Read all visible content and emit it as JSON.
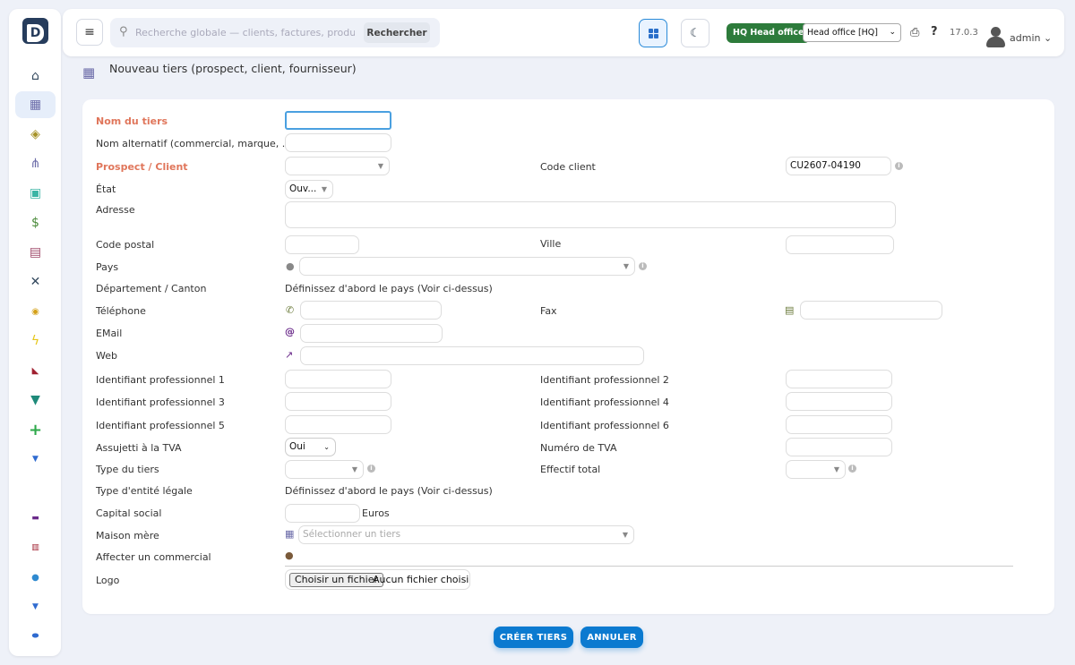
{
  "header": {
    "search_placeholder": "Recherche globale — clients, factures, produits...",
    "search_button": "Rechercher",
    "hq_badge": "HQ Head office",
    "hq_select": "Head office [HQ]",
    "version": "17.0.3",
    "user": "admin"
  },
  "page": {
    "title": "Nouveau tiers (prospect, client, fournisseur)"
  },
  "form": {
    "nom_tiers": "Nom du tiers",
    "nom_alternatif": "Nom alternatif (commercial, marque, ...)",
    "prospect_client": "Prospect / Client",
    "code_client_label": "Code client",
    "code_client_value": "CU2607-04190",
    "etat_label": "État",
    "etat_value": "Ouv...",
    "adresse": "Adresse",
    "code_postal": "Code postal",
    "ville": "Ville",
    "pays": "Pays",
    "departement": "Département / Canton",
    "departement_hint": "Définissez d'abord le pays (Voir ci-dessus)",
    "telephone": "Téléphone",
    "fax": "Fax",
    "email": "EMail",
    "web": "Web",
    "idprof1": "Identifiant professionnel 1",
    "idprof2": "Identifiant professionnel 2",
    "idprof3": "Identifiant professionnel 3",
    "idprof4": "Identifiant professionnel 4",
    "idprof5": "Identifiant professionnel 5",
    "idprof6": "Identifiant professionnel 6",
    "tva_label": "Assujetti à la TVA",
    "tva_value": "Oui",
    "num_tva": "Numéro de TVA",
    "type_tiers": "Type du tiers",
    "effectif": "Effectif total",
    "type_entite": "Type d'entité légale",
    "type_entite_hint": "Définissez d'abord le pays (Voir ci-dessus)",
    "capital": "Capital social",
    "capital_unit": "Euros",
    "maison_mere": "Maison mère",
    "maison_mere_placeholder": "Sélectionner un tiers",
    "commercial": "Affecter un commercial",
    "logo": "Logo",
    "file_button": "Choisir un fichier",
    "file_none": "Aucun fichier choisi"
  },
  "actions": {
    "create": "CRÉER TIERS",
    "cancel": "ANNULER"
  },
  "colors": {
    "accent": "#0b7ad0",
    "required": "#e0765b",
    "hq_green": "#2d7b3b"
  }
}
